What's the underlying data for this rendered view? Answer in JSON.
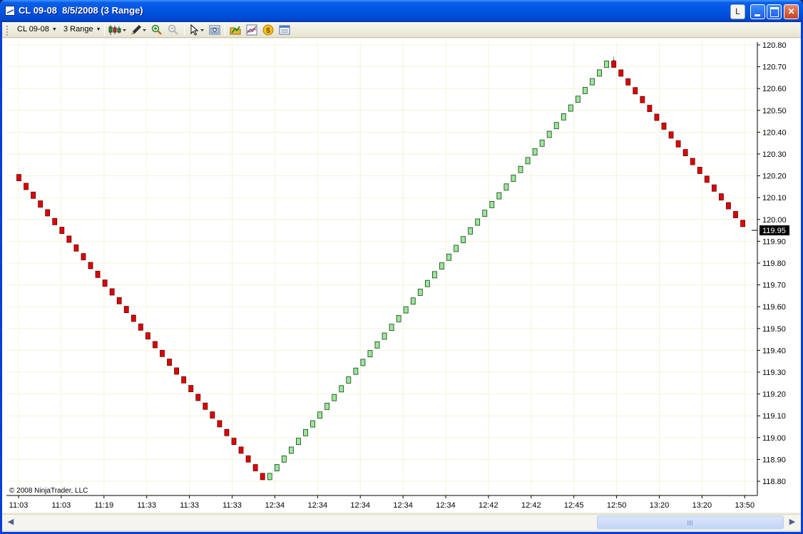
{
  "window": {
    "title": "CL 09-08  8/5/2008 (3 Range)",
    "layout_button": "L"
  },
  "toolbar": {
    "instrument": "CL 09-08",
    "period": "3 Range",
    "icons": [
      "chart-style-icon",
      "drawing-tools-icon",
      "zoom-in-icon",
      "zoom-out-icon",
      "pointer-icon",
      "data-box-icon",
      "strategies-icon",
      "indicators-icon",
      "order-entry-icon",
      "properties-icon"
    ]
  },
  "chart": {
    "copyright": "© 2008 NinjaTrader, LLC",
    "current_price": "119.95",
    "marker": "↓",
    "colors": {
      "down_bar": "#e00000",
      "up_bar": "#98e898",
      "grid": "#f5f1dc",
      "label_bg": "#000000"
    }
  },
  "chart_data": {
    "type": "candlestick",
    "instrument": "CL 09-08",
    "bar_type": "3 Range",
    "y_ticks": [
      "120.80",
      "120.70",
      "120.60",
      "120.50",
      "120.40",
      "120.30",
      "120.20",
      "120.10",
      "120.00",
      "119.90",
      "119.80",
      "119.70",
      "119.60",
      "119.50",
      "119.40",
      "119.30",
      "119.20",
      "119.10",
      "119.00",
      "118.90",
      "118.80"
    ],
    "x_ticks": [
      "11:03",
      "11:03",
      "11:19",
      "11:33",
      "11:33",
      "11:33",
      "12:34",
      "12:34",
      "12:34",
      "12:34",
      "12:34",
      "12:42",
      "12:42",
      "12:45",
      "12:50",
      "13:20",
      "13:20",
      "13:50"
    ],
    "ylim": [
      118.77,
      120.82
    ],
    "legs": [
      {
        "direction": "down",
        "from": 120.19,
        "to": 118.82,
        "bars": 35
      },
      {
        "direction": "up",
        "from": 118.82,
        "to": 120.71,
        "bars": 48
      },
      {
        "direction": "down",
        "from": 120.71,
        "to": 119.98,
        "bars": 19
      }
    ],
    "last_price": 119.95
  }
}
